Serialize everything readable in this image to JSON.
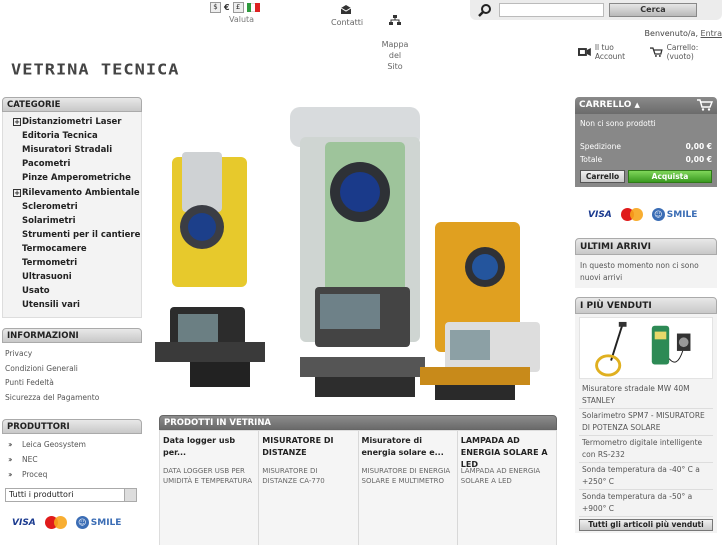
{
  "header": {
    "currency_symbols": [
      "$",
      "€",
      "£"
    ],
    "currency_label": "Valuta",
    "contact_label": "Contatti",
    "sitemap_label": "Mappa del\nSito",
    "search_placeholder": "",
    "search_button": "Cerca",
    "welcome_text": "Benvenuto/a,",
    "login_link": "Entra",
    "account_label": "Il tuo Account",
    "cart_link": "Carrello: (vuoto)",
    "logo_text": "VETRINA TECNICA"
  },
  "categories": {
    "title": "CATEGORIE",
    "items": [
      {
        "label": "Distanziometri Laser",
        "expandable": true
      },
      {
        "label": "Editoria Tecnica",
        "expandable": false
      },
      {
        "label": "Misuratori Stradali",
        "expandable": false
      },
      {
        "label": "Pacometri",
        "expandable": false
      },
      {
        "label": "Pinze Amperometriche",
        "expandable": false
      },
      {
        "label": "Rilevamento Ambientale",
        "expandable": true
      },
      {
        "label": "Sclerometri",
        "expandable": false
      },
      {
        "label": "Solarimetri",
        "expandable": false
      },
      {
        "label": "Strumenti per il cantiere",
        "expandable": false
      },
      {
        "label": "Termocamere",
        "expandable": false
      },
      {
        "label": "Termometri",
        "expandable": false
      },
      {
        "label": "Ultrasuoni",
        "expandable": false
      },
      {
        "label": "Usato",
        "expandable": false
      },
      {
        "label": "Utensili vari",
        "expandable": false
      }
    ]
  },
  "informazioni": {
    "title": "INFORMAZIONI",
    "items": [
      "Privacy",
      "Condizioni Generali",
      "Punti Fedeltà",
      "Sicurezza del Pagamento"
    ]
  },
  "produttori": {
    "title": "PRODUTTORI",
    "items": [
      "Leica Geosystem",
      "NEC",
      "Proceq"
    ],
    "select_value": "Tutti i produttori"
  },
  "payments": {
    "visa": "VISA",
    "smile": "SMILE"
  },
  "vetrina": {
    "title": "PRODOTTI IN VETRINA",
    "products": [
      {
        "title": "Data logger usb per...",
        "desc": "DATA LOGGER USB PER UMIDITÀ E TEMPERATURA"
      },
      {
        "title": "MISURATORE DI DISTANZE",
        "desc": "MISURATORE DI DISTANZE CA-770"
      },
      {
        "title": "Misuratore di energia solare e...",
        "desc": "MISURATORE DI ENERGIA SOLARE E MULTIMETRO"
      },
      {
        "title": "LAMPADA AD ENERGIA SOLARE A LED",
        "desc": "LAMPADA AD ENERGIA SOLARE A LED"
      }
    ]
  },
  "cart": {
    "title": "CARRELLO",
    "empty_text": "Non ci sono prodotti",
    "shipping_label": "Spedizione",
    "shipping_value": "0,00 €",
    "total_label": "Totale",
    "total_value": "0,00 €",
    "cart_button": "Carrello",
    "buy_button": "Acquista"
  },
  "ultimi_arrivi": {
    "title": "ULTIMI ARRIVI",
    "text": "In questo momento non ci sono nuovi arrivi"
  },
  "piu_venduti": {
    "title": "I PIÙ VENDUTI",
    "items": [
      "Misuratore stradale MW 40M STANLEY",
      "Solarimetro SPM7 - MISURATORE DI POTENZA SOLARE",
      "Termometro digitale intelligente con RS-232",
      "Sonda temperatura da -40° C a +250° C",
      "Sonda temperatura da -50° a +900° C"
    ],
    "button": "Tutti gli articoli più venduti"
  },
  "colors": {
    "accent_green": "#3a9a20",
    "panel_dark": "#7a7a7a",
    "visa_blue": "#1a3a8f"
  }
}
